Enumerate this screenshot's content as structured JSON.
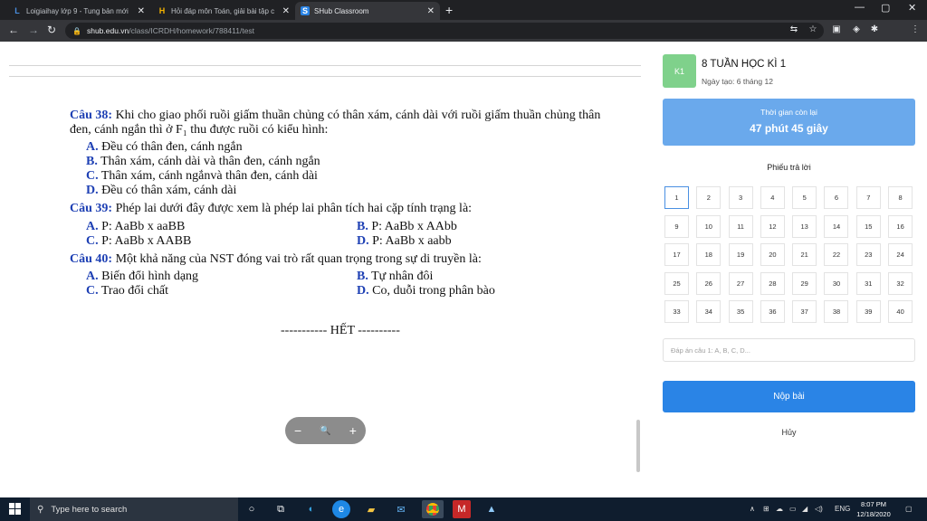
{
  "browser": {
    "tabs": [
      {
        "title": "Loigiaihay lớp 9 - Tung bản mới",
        "icon": "L"
      },
      {
        "title": "Hỏi đáp môn Toán, giải bài tập c",
        "icon": "H"
      },
      {
        "title": "SHub Classroom",
        "icon": "S"
      }
    ],
    "url_host": "shub.edu.vn",
    "url_path": "/class/ICRDH/homework/788411/test"
  },
  "questions": {
    "q38": {
      "label": "Câu 38:",
      "line1": " Khi cho giao phối ruồi giấm thuần chủng có thân xám, cánh dài với ruồi giấm thuần chủng thân",
      "line2": "đen, cánh ngắn  thì ở F₁ thu được ruồi có kiểu hình:",
      "options": [
        {
          "letter": "A.",
          "text": " Đều có thân đen, cánh ngắn"
        },
        {
          "letter": "B.",
          "text": " Thân xám, cánh dài và thân đen, cánh ngắn"
        },
        {
          "letter": "C.",
          "text": " Thân xám, cánh ngắnvà thân đen, cánh dài"
        },
        {
          "letter": "D.",
          "text": " Đều có thân xám, cánh dài"
        }
      ]
    },
    "q39": {
      "label": "Câu 39:",
      "line1": " Phép lai dưới đây được xem là phép lai phân tích hai cặp tính trạng là:",
      "options": [
        {
          "letter": "A.",
          "text": " P: AaBb x aaBB"
        },
        {
          "letter": "B.",
          "text": " P: AaBb x AAbb"
        },
        {
          "letter": "C.",
          "text": " P:  AaBb x AABB"
        },
        {
          "letter": "D.",
          "text": " P: AaBb x aabb"
        }
      ]
    },
    "q40": {
      "label": "Câu 40:",
      "line1": " Một khả năng của NST đóng vai trò rất quan trọng trong sự di truyền là:",
      "options": [
        {
          "letter": "A.",
          "text": " Biến đổi hình dạng"
        },
        {
          "letter": "B.",
          "text": " Tự nhân đôi"
        },
        {
          "letter": "C.",
          "text": " Trao đổi chất"
        },
        {
          "letter": "D.",
          "text": " Co, duỗi trong phân bào"
        }
      ]
    },
    "end_text": "----------- HẾT ----------"
  },
  "zoom": {
    "minus": "−",
    "search": "🔍",
    "plus": "+"
  },
  "panel": {
    "badge": "K1",
    "title": "8 TUẦN HỌC KÌ 1",
    "created": "Ngày tạo: 6 tháng 12",
    "timer_label": "Thời gian còn lại",
    "timer_value": "47 phút 45 giây",
    "sheet_title": "Phiếu trả lời",
    "answer_placeholder": "Đáp án câu 1: A, B, C, D...",
    "submit": "Nộp bài",
    "cancel": "Hủy"
  },
  "taskbar": {
    "search_placeholder": "Type here to search",
    "lang": "ENG",
    "time": "8:07 PM",
    "date": "12/18/2020"
  }
}
